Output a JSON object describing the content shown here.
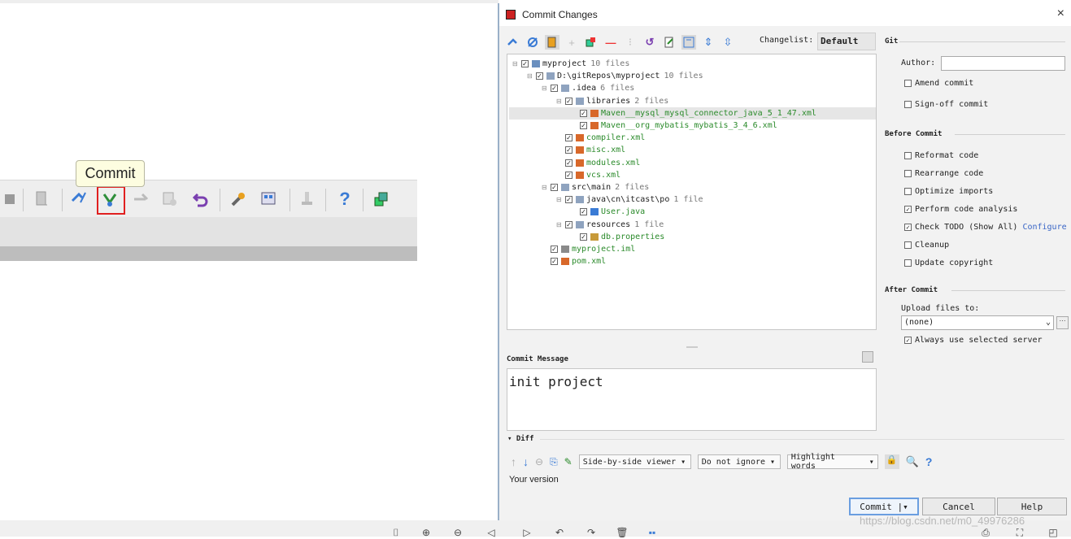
{
  "tooltip": "Commit",
  "dialog": {
    "title": "Commit Changes",
    "close": "×",
    "changelist_label": "Changelist:",
    "changelist_value": "Default",
    "tree": [
      {
        "label": "myproject",
        "count": "10 files",
        "indent": 0,
        "color": "normal",
        "icon": "project"
      },
      {
        "label": "D:\\gitRepos\\myproject",
        "count": "10 files",
        "indent": 1,
        "color": "normal",
        "icon": "folder"
      },
      {
        "label": ".idea",
        "count": "6 files",
        "indent": 2,
        "color": "normal",
        "icon": "folder"
      },
      {
        "label": "libraries",
        "count": "2 files",
        "indent": 3,
        "color": "normal",
        "icon": "folder"
      },
      {
        "label": "Maven__mysql_mysql_connector_java_5_1_47.xml",
        "count": "",
        "indent": 4,
        "color": "green",
        "icon": "xml",
        "selected": true
      },
      {
        "label": "Maven__org_mybatis_mybatis_3_4_6.xml",
        "count": "",
        "indent": 4,
        "color": "green",
        "icon": "xml"
      },
      {
        "label": "compiler.xml",
        "count": "",
        "indent": 3,
        "color": "green",
        "icon": "xml"
      },
      {
        "label": "misc.xml",
        "count": "",
        "indent": 3,
        "color": "green",
        "icon": "xml"
      },
      {
        "label": "modules.xml",
        "count": "",
        "indent": 3,
        "color": "green",
        "icon": "xml"
      },
      {
        "label": "vcs.xml",
        "count": "",
        "indent": 3,
        "color": "green",
        "icon": "xml"
      },
      {
        "label": "src\\main",
        "count": "2 files",
        "indent": 2,
        "color": "normal",
        "icon": "folder"
      },
      {
        "label": "java\\cn\\itcast\\po",
        "count": "1 file",
        "indent": 3,
        "color": "normal",
        "icon": "folder"
      },
      {
        "label": "User.java",
        "count": "",
        "indent": 4,
        "color": "green",
        "icon": "java"
      },
      {
        "label": "resources",
        "count": "1 file",
        "indent": 3,
        "color": "normal",
        "icon": "folder"
      },
      {
        "label": "db.properties",
        "count": "",
        "indent": 4,
        "color": "green",
        "icon": "props"
      },
      {
        "label": "myproject.iml",
        "count": "",
        "indent": 2,
        "color": "green",
        "icon": "iml"
      },
      {
        "label": "pom.xml",
        "count": "",
        "indent": 2,
        "color": "green",
        "icon": "xml"
      }
    ],
    "commit_message_label": "Commit Message",
    "commit_message": "init project",
    "diff_label": "Diff",
    "diff_viewer": "Side-by-side viewer",
    "diff_ignore": "Do not ignore",
    "diff_highlight": "Highlight words",
    "your_version": "Your version",
    "git": {
      "title": "Git",
      "author_label": "Author:",
      "author_value": "",
      "amend": "Amend commit",
      "signoff": "Sign-off commit"
    },
    "before_commit": {
      "title": "Before Commit",
      "options": [
        {
          "label": "Reformat code",
          "checked": false
        },
        {
          "label": "Rearrange code",
          "checked": false
        },
        {
          "label": "Optimize imports",
          "checked": false
        },
        {
          "label": "Perform code analysis",
          "checked": true
        },
        {
          "label": "Check TODO (Show All)",
          "checked": true
        },
        {
          "label": "Cleanup",
          "checked": false
        },
        {
          "label": "Update copyright",
          "checked": false
        }
      ],
      "configure": "Configure"
    },
    "after_commit": {
      "title": "After Commit",
      "upload_label": "Upload files to:",
      "upload_value": "(none)",
      "always_use": "Always use selected server"
    },
    "buttons": {
      "commit": "Commit",
      "cancel": "Cancel",
      "help": "Help"
    }
  },
  "watermark": "https://blog.csdn.net/m0_49976286",
  "colors": {
    "accent": "#2a8a2a",
    "highlight_box": "#e02020",
    "link": "#3a66c6"
  }
}
